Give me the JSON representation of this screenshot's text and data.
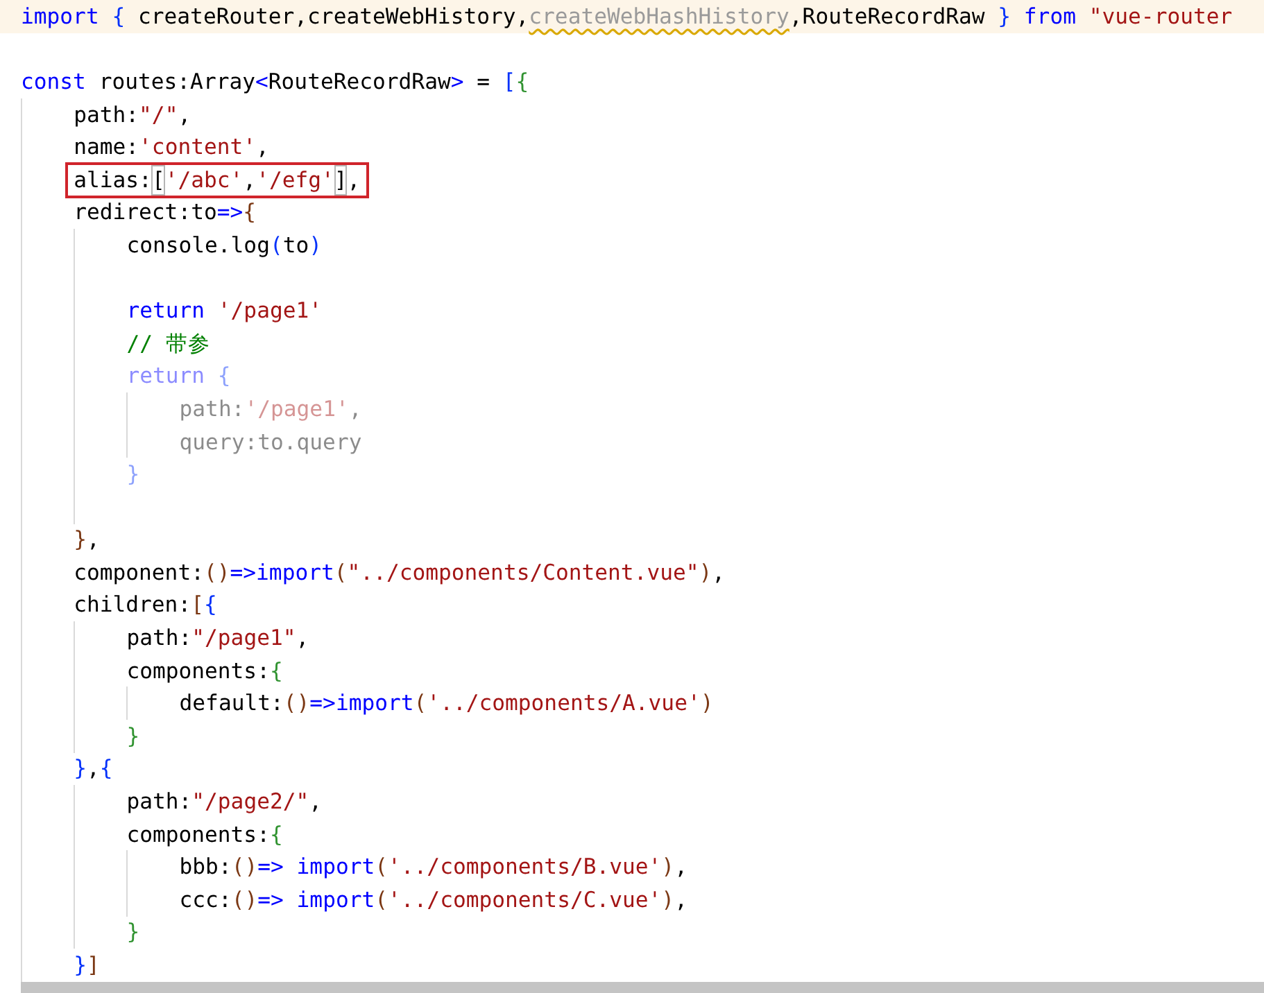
{
  "editor": {
    "lines": [
      {
        "kind": "code",
        "current": true,
        "tokens": [
          {
            "text": "import ",
            "kind": "keyword"
          },
          {
            "text": "{",
            "kind": "bracket-1"
          },
          {
            "text": " createRouter,createWebHistory,",
            "kind": "plain"
          },
          {
            "text": "createWebHashHistory",
            "kind": "deprecated"
          },
          {
            "text": ",RouteRecordRaw ",
            "kind": "plain"
          },
          {
            "text": "} ",
            "kind": "bracket-1"
          },
          {
            "text": "from ",
            "kind": "keyword"
          },
          {
            "text": "\"vue-router",
            "kind": "string"
          }
        ]
      },
      {
        "kind": "blank"
      },
      {
        "kind": "code",
        "tokens": [
          {
            "text": "const",
            "kind": "keyword"
          },
          {
            "text": " routes:Array",
            "kind": "plain"
          },
          {
            "text": "<",
            "kind": "keyword"
          },
          {
            "text": "RouteRecordRaw",
            "kind": "plain"
          },
          {
            "text": ">",
            "kind": "keyword"
          },
          {
            "text": " = ",
            "kind": "plain"
          },
          {
            "text": "[",
            "kind": "bracket-1"
          },
          {
            "text": "{",
            "kind": "bracket-2"
          }
        ],
        "children": [
          {
            "kind": "code",
            "tokens": [
              {
                "text": "path:",
                "kind": "plain"
              },
              {
                "text": "\"/\"",
                "kind": "string"
              },
              {
                "text": ",",
                "kind": "plain"
              }
            ]
          },
          {
            "kind": "code",
            "tokens": [
              {
                "text": "name:",
                "kind": "plain"
              },
              {
                "text": "'content'",
                "kind": "string"
              },
              {
                "text": ",",
                "kind": "plain"
              }
            ]
          },
          {
            "kind": "code",
            "boxed": true,
            "tokens": [
              {
                "text": "alias:",
                "kind": "plain"
              },
              {
                "text": "[",
                "kind": "bracket-match"
              },
              {
                "text": "'/abc'",
                "kind": "string"
              },
              {
                "text": ",",
                "kind": "plain"
              },
              {
                "text": "'/efg'",
                "kind": "string"
              },
              {
                "text": "]",
                "kind": "bracket-match"
              },
              {
                "text": ",",
                "kind": "plain"
              }
            ]
          },
          {
            "kind": "code",
            "tokens": [
              {
                "text": "redirect:to",
                "kind": "plain"
              },
              {
                "text": "=>",
                "kind": "keyword"
              },
              {
                "text": "{",
                "kind": "bracket-3"
              }
            ],
            "children": [
              {
                "kind": "code",
                "tokens": [
                  {
                    "text": "console.log",
                    "kind": "plain"
                  },
                  {
                    "text": "(",
                    "kind": "bracket-1"
                  },
                  {
                    "text": "to",
                    "kind": "plain"
                  },
                  {
                    "text": ")",
                    "kind": "bracket-1"
                  }
                ]
              },
              {
                "kind": "blank"
              },
              {
                "kind": "code",
                "tokens": [
                  {
                    "text": "return ",
                    "kind": "keyword"
                  },
                  {
                    "text": "'/page1'",
                    "kind": "string"
                  }
                ]
              },
              {
                "kind": "code",
                "tokens": [
                  {
                    "text": "// 带参",
                    "kind": "comment"
                  }
                ]
              },
              {
                "kind": "code",
                "faded": true,
                "tokens": [
                  {
                    "text": "return ",
                    "kind": "keyword"
                  },
                  {
                    "text": "{",
                    "kind": "bracket-1"
                  }
                ],
                "children": [
                  {
                    "kind": "code",
                    "faded": true,
                    "tokens": [
                      {
                        "text": "path:",
                        "kind": "plain"
                      },
                      {
                        "text": "'/page1'",
                        "kind": "string"
                      },
                      {
                        "text": ",",
                        "kind": "plain"
                      }
                    ]
                  },
                  {
                    "kind": "code",
                    "faded": true,
                    "tokens": [
                      {
                        "text": "query:to.query",
                        "kind": "plain"
                      }
                    ]
                  }
                ]
              },
              {
                "kind": "code",
                "faded": true,
                "tokens": [
                  {
                    "text": "}",
                    "kind": "bracket-1"
                  }
                ]
              },
              {
                "kind": "blank"
              }
            ]
          },
          {
            "kind": "code",
            "tokens": [
              {
                "text": "}",
                "kind": "bracket-3"
              },
              {
                "text": ",",
                "kind": "plain"
              }
            ]
          },
          {
            "kind": "code",
            "tokens": [
              {
                "text": "component:",
                "kind": "plain"
              },
              {
                "text": "()",
                "kind": "bracket-3"
              },
              {
                "text": "=>",
                "kind": "keyword"
              },
              {
                "text": "import",
                "kind": "keyword"
              },
              {
                "text": "(",
                "kind": "bracket-3"
              },
              {
                "text": "\"../components/Content.vue\"",
                "kind": "string"
              },
              {
                "text": ")",
                "kind": "bracket-3"
              },
              {
                "text": ",",
                "kind": "plain"
              }
            ]
          },
          {
            "kind": "code",
            "tokens": [
              {
                "text": "children:",
                "kind": "plain"
              },
              {
                "text": "[",
                "kind": "bracket-3"
              },
              {
                "text": "{",
                "kind": "bracket-1"
              }
            ],
            "children": [
              {
                "kind": "code",
                "tokens": [
                  {
                    "text": "path:",
                    "kind": "plain"
                  },
                  {
                    "text": "\"/page1\"",
                    "kind": "string"
                  },
                  {
                    "text": ",",
                    "kind": "plain"
                  }
                ]
              },
              {
                "kind": "code",
                "tokens": [
                  {
                    "text": "components:",
                    "kind": "plain"
                  },
                  {
                    "text": "{",
                    "kind": "bracket-2"
                  }
                ],
                "children": [
                  {
                    "kind": "code",
                    "tokens": [
                      {
                        "text": "default:",
                        "kind": "plain"
                      },
                      {
                        "text": "()",
                        "kind": "bracket-3"
                      },
                      {
                        "text": "=>",
                        "kind": "keyword"
                      },
                      {
                        "text": "import",
                        "kind": "keyword"
                      },
                      {
                        "text": "(",
                        "kind": "bracket-3"
                      },
                      {
                        "text": "'../components/A.vue'",
                        "kind": "string"
                      },
                      {
                        "text": ")",
                        "kind": "bracket-3"
                      }
                    ]
                  }
                ]
              },
              {
                "kind": "code",
                "tokens": [
                  {
                    "text": "}",
                    "kind": "bracket-2"
                  }
                ]
              }
            ]
          },
          {
            "kind": "code",
            "tokens": [
              {
                "text": "}",
                "kind": "bracket-1"
              },
              {
                "text": ",",
                "kind": "plain"
              },
              {
                "text": "{",
                "kind": "bracket-1"
              }
            ],
            "children": [
              {
                "kind": "code",
                "tokens": [
                  {
                    "text": "path:",
                    "kind": "plain"
                  },
                  {
                    "text": "\"/page2/\"",
                    "kind": "string"
                  },
                  {
                    "text": ",",
                    "kind": "plain"
                  }
                ]
              },
              {
                "kind": "code",
                "tokens": [
                  {
                    "text": "components:",
                    "kind": "plain"
                  },
                  {
                    "text": "{",
                    "kind": "bracket-2"
                  }
                ],
                "children": [
                  {
                    "kind": "code",
                    "tokens": [
                      {
                        "text": "bbb:",
                        "kind": "plain"
                      },
                      {
                        "text": "()",
                        "kind": "bracket-3"
                      },
                      {
                        "text": "=> import",
                        "kind": "keyword"
                      },
                      {
                        "text": "(",
                        "kind": "bracket-3"
                      },
                      {
                        "text": "'../components/B.vue'",
                        "kind": "string"
                      },
                      {
                        "text": ")",
                        "kind": "bracket-3"
                      },
                      {
                        "text": ",",
                        "kind": "plain"
                      }
                    ]
                  },
                  {
                    "kind": "code",
                    "tokens": [
                      {
                        "text": "ccc:",
                        "kind": "plain"
                      },
                      {
                        "text": "()",
                        "kind": "bracket-3"
                      },
                      {
                        "text": "=> import",
                        "kind": "keyword"
                      },
                      {
                        "text": "(",
                        "kind": "bracket-3"
                      },
                      {
                        "text": "'../components/C.vue'",
                        "kind": "string"
                      },
                      {
                        "text": ")",
                        "kind": "bracket-3"
                      },
                      {
                        "text": ",",
                        "kind": "plain"
                      }
                    ]
                  }
                ]
              },
              {
                "kind": "code",
                "tokens": [
                  {
                    "text": "}",
                    "kind": "bracket-2"
                  }
                ]
              }
            ]
          },
          {
            "kind": "code",
            "tokens": [
              {
                "text": "}",
                "kind": "bracket-1"
              },
              {
                "text": "]",
                "kind": "bracket-3"
              }
            ]
          }
        ]
      }
    ]
  }
}
